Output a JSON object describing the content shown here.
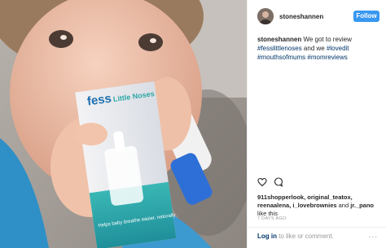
{
  "post": {
    "username": "stoneshannen",
    "follow_label": "Follow",
    "caption": {
      "user": "stoneshannen",
      "text": " We got to review",
      "tags": [
        "#fesslittlenoses",
        "#lovedit",
        "#mouthsofmums",
        "#momreviews"
      ],
      "tag_joiner": " and we "
    },
    "likes": {
      "names": "911shopperlook, original_teatox, reenaalena, i_lovebrownies",
      "tail": " and ",
      "last": "jr._pano",
      "suffix": " like this"
    },
    "timestamp": "7 DAYS AGO",
    "footer": {
      "login_label": "Log in",
      "rest": " to like or comment.",
      "more_label": "..."
    }
  },
  "photo": {
    "package_brand": "fess",
    "package_line": "Little Noses",
    "package_bottom": "Helps baby breathe easier, naturally"
  },
  "icons": {
    "heart": "heart-icon",
    "comment": "comment-icon",
    "more": "more-icon"
  },
  "colors": {
    "follow": "#3897f0",
    "hashtag": "#003569",
    "muted": "#999999"
  }
}
